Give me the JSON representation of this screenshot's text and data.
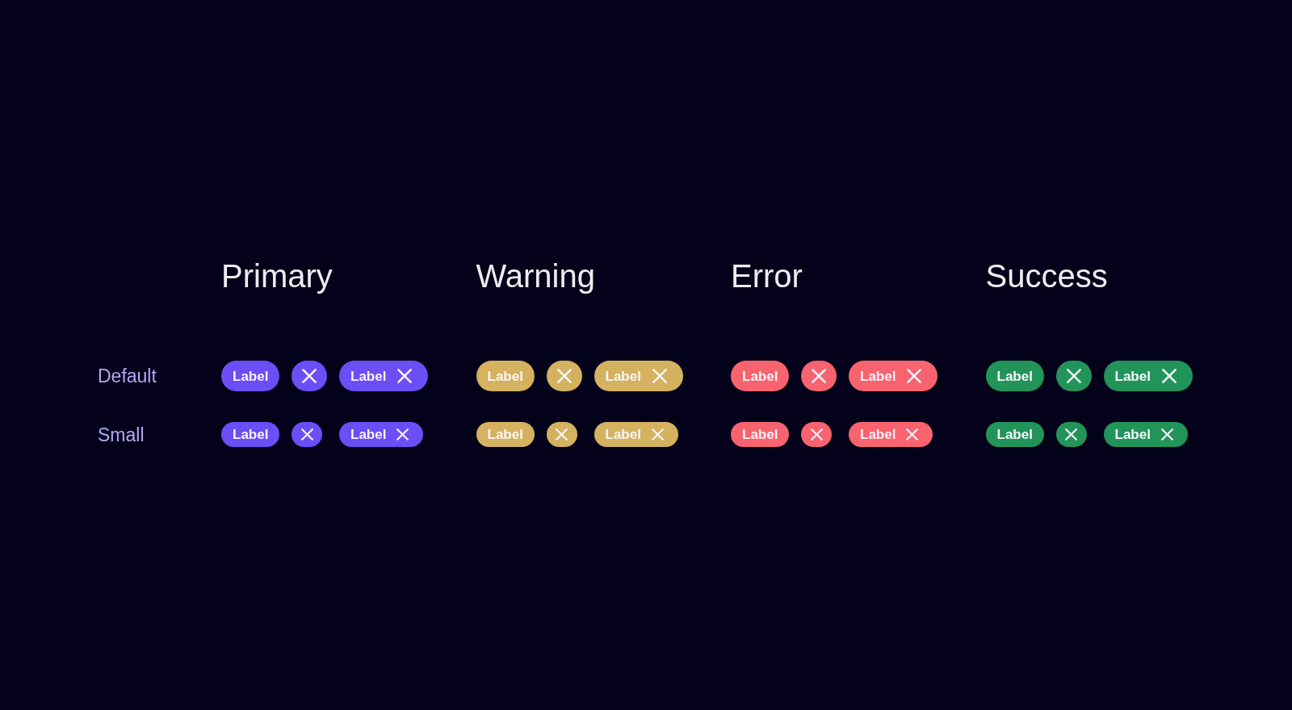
{
  "columns": [
    {
      "title": "Primary",
      "color": "#6b4ef6"
    },
    {
      "title": "Warning",
      "color": "#d5b260"
    },
    {
      "title": "Error",
      "color": "#f7636f"
    },
    {
      "title": "Success",
      "color": "#22945a"
    }
  ],
  "rows": [
    {
      "label": "Default",
      "kind": "default",
      "groups": [
        {
          "tags": [
            {
              "kind": "text",
              "text": "Label"
            },
            {
              "kind": "remove"
            },
            {
              "kind": "text-remove",
              "text": "Label"
            }
          ]
        },
        {
          "tags": [
            {
              "kind": "text",
              "text": "Label"
            },
            {
              "kind": "remove"
            },
            {
              "kind": "text-remove",
              "text": "Label"
            }
          ]
        },
        {
          "tags": [
            {
              "kind": "text",
              "text": "Label"
            },
            {
              "kind": "remove"
            },
            {
              "kind": "text-remove",
              "text": "Label"
            }
          ]
        },
        {
          "tags": [
            {
              "kind": "text",
              "text": "Label"
            },
            {
              "kind": "remove"
            },
            {
              "kind": "text-remove",
              "text": "Label"
            }
          ]
        }
      ]
    },
    {
      "label": "Small",
      "kind": "small",
      "groups": [
        {
          "tags": [
            {
              "kind": "text",
              "text": "Label"
            },
            {
              "kind": "remove"
            },
            {
              "kind": "text-remove",
              "text": "Label"
            }
          ]
        },
        {
          "tags": [
            {
              "kind": "text",
              "text": "Label"
            },
            {
              "kind": "remove"
            },
            {
              "kind": "text-remove",
              "text": "Label"
            }
          ]
        },
        {
          "tags": [
            {
              "kind": "text",
              "text": "Label"
            },
            {
              "kind": "remove"
            },
            {
              "kind": "text-remove",
              "text": "Label"
            }
          ]
        },
        {
          "tags": [
            {
              "kind": "text",
              "text": "Label"
            },
            {
              "kind": "remove"
            },
            {
              "kind": "text-remove",
              "text": "Label"
            }
          ]
        }
      ]
    }
  ]
}
